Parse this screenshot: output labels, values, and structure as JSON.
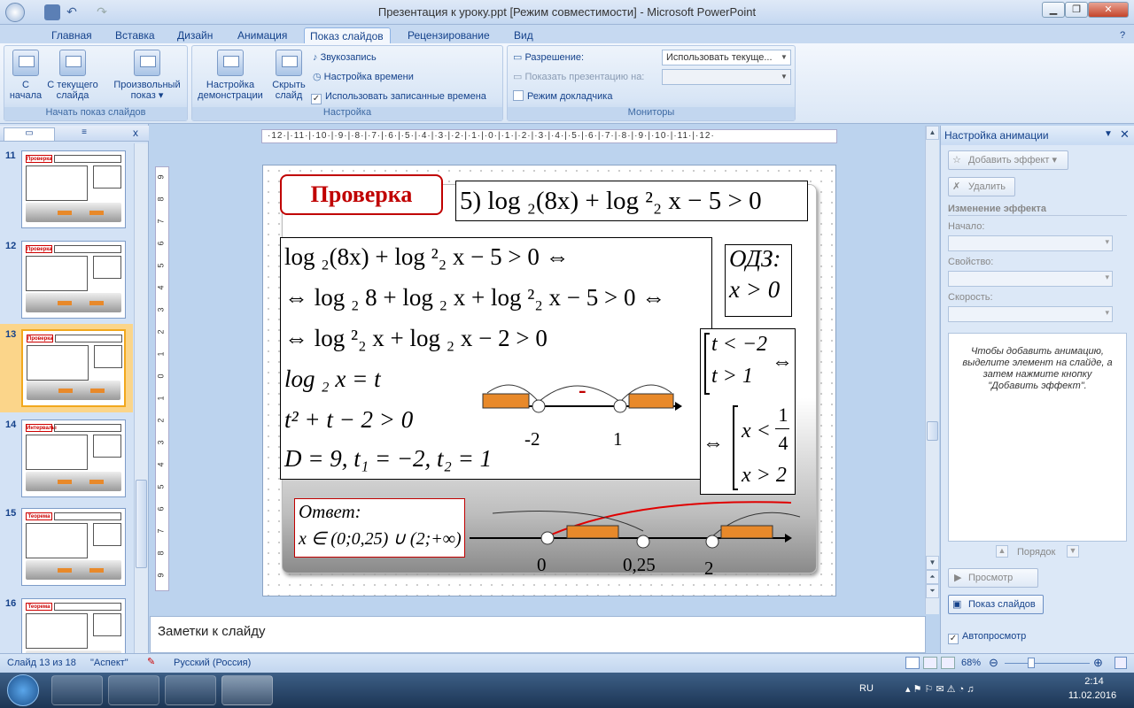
{
  "window": {
    "title": "Презентация к уроку.ppt [Режим совместимости] - Microsoft PowerPoint"
  },
  "tabs": [
    "Главная",
    "Вставка",
    "Дизайн",
    "Анимация",
    "Показ слайдов",
    "Рецензирование",
    "Вид"
  ],
  "active_tab": "Показ слайдов",
  "ribbon": {
    "start_group": {
      "label": "Начать показ слайдов",
      "from_start_l1": "С",
      "from_start_l2": "начала",
      "current_l1": "С текущего",
      "current_l2": "слайда",
      "custom_l1": "Произвольный",
      "custom_l2": "показ ▾"
    },
    "setup_group": {
      "label": "Настройка",
      "setup_l1": "Настройка",
      "setup_l2": "демонстрации",
      "hide_l1": "Скрыть",
      "hide_l2": "слайд",
      "record": "Звукозапись",
      "timing": "Настройка времени",
      "use_timings": "Использовать записанные времена",
      "use_timings_checked": true
    },
    "monitors_group": {
      "label": "Мониторы",
      "resolution_label": "Разрешение:",
      "resolution_value": "Использовать текуще...",
      "show_on_label": "Показать презентацию на:",
      "show_on_value": "",
      "presenter_view": "Режим докладчика"
    }
  },
  "thumbnails": [
    {
      "num": "11",
      "title": "Проверка"
    },
    {
      "num": "12",
      "title": "Проверка"
    },
    {
      "num": "13",
      "title": "Проверка",
      "selected": true
    },
    {
      "num": "14",
      "title": "Интервалы"
    },
    {
      "num": "15",
      "title": "Теорема"
    },
    {
      "num": "16",
      "title": "Теорема"
    }
  ],
  "ruler_h": "·12·|·11·|·10·|·9·|·8·|·7·|·6·|·5·|·4·|·3·|·2·|·1·|·0·|·1·|·2·|·3·|·4·|·5·|·6·|·7·|·8·|·9·|·10·|·11·|·12·",
  "slide": {
    "header": "Проверка",
    "task": "5) log ₂(8x) + log ²₂ x − 5 > 0",
    "steps": [
      "log ₂(8x) + log ²₂ x − 5 > 0 ⇔",
      "⇔ log ₂ 8 + log ₂ x + log ²₂ x − 5 > 0 ⇔",
      "⇔ log ²₂ x + log ₂ x − 2 > 0",
      "log ₂ x = t",
      "t² + t − 2 > 0",
      "D = 9, t₁ = −2, t₂ = 1"
    ],
    "odz_title": "ОДЗ:",
    "odz_value": "x > 0",
    "system_t1": "t < −2",
    "system_t2": "t > 1",
    "system_x1": "x <",
    "system_frac_num": "1",
    "system_frac_den": "4",
    "system_x2": "x > 2",
    "equiv": "⇔",
    "numline1_minus": "-",
    "numline1_a": "-2",
    "numline1_b": "1",
    "answer_label": "Ответ:",
    "answer_value": "x ∈ (0;0,25) ∪ (2;+∞)",
    "numline2_a": "0",
    "numline2_b": "0,25",
    "numline2_c": "2"
  },
  "notes_placeholder": "Заметки к слайду",
  "anim_panel": {
    "title": "Настройка анимации",
    "add_effect": "Добавить эффект ▾",
    "remove": "Удалить",
    "change_effect": "Изменение эффекта",
    "start": "Начало:",
    "property": "Свойство:",
    "speed": "Скорость:",
    "hint": "Чтобы добавить анимацию, выделите элемент на слайде, а затем нажмите кнопку \"Добавить эффект\".",
    "order": "Порядок",
    "preview": "Просмотр",
    "slideshow": "Показ слайдов",
    "autopreview": "Автопросмотр"
  },
  "status": {
    "slide": "Слайд 13 из 18",
    "theme": "\"Аспект\"",
    "lang": "Русский (Россия)",
    "zoom": "68%"
  },
  "taskbar": {
    "lang": "RU",
    "time": "2:14",
    "date": "11.02.2016"
  },
  "colors": {
    "accent_red": "#c00000",
    "bar_orange": "#e8892a"
  }
}
